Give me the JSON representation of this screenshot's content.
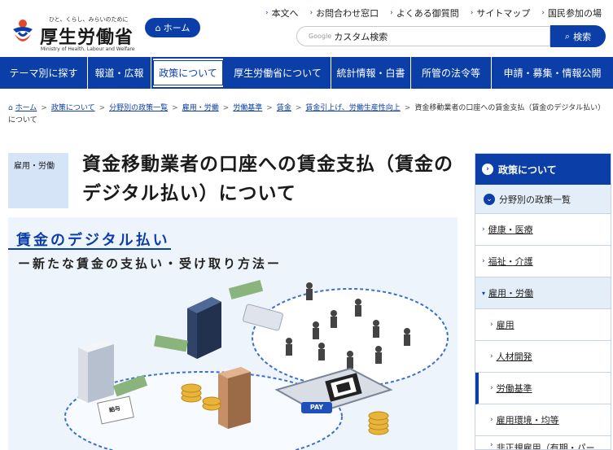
{
  "header": {
    "logo_tagline": "ひと、くらし、みらいのために",
    "logo_name": "厚生労働省",
    "logo_en": "Ministry of Health, Labour and Welfare",
    "home_button": "ホーム",
    "util_links": [
      "本文へ",
      "お問合わせ窓口",
      "よくある御質問",
      "サイトマップ",
      "国民参加の場"
    ],
    "search_brand": "Google",
    "search_placeholder": "カスタム検索",
    "search_button": "検索"
  },
  "gnav": {
    "tabs": [
      "テーマ別に探す",
      "報道・広報",
      "政策について",
      "厚生労働省について",
      "統計情報・白書",
      "所管の法令等",
      "申請・募集・情報公開"
    ],
    "active_index": 2
  },
  "breadcrumb": {
    "items": [
      "ホーム",
      "政策について",
      "分野別の政策一覧",
      "雇用・労働",
      "労働基準",
      "賃金",
      "賃金引上げ、労働生産性向上"
    ],
    "current": "資金移動業者の口座への賃金支払（賃金のデジタル払い）について"
  },
  "page": {
    "category": "雇用・労働",
    "title": "資金移動業者の口座への賃金支払（賃金のデジタル払い）について"
  },
  "hero": {
    "title": "賃金のデジタル払い",
    "subtitle": "ー新たな賃金の支払い・受け取り方法ー",
    "pay_label": "PAY",
    "payslip_label": "給与"
  },
  "sidebar": {
    "heading": "政策について",
    "subheading": "分野別の政策一覧",
    "items": [
      {
        "label": "健康・医療",
        "level": 0
      },
      {
        "label": "福祉・介護",
        "level": 0
      },
      {
        "label": "雇用・労働",
        "level": 0,
        "open": true
      },
      {
        "label": "雇用",
        "level": 1
      },
      {
        "label": "人材開発",
        "level": 1
      },
      {
        "label": "労働基準",
        "level": 1,
        "current": true
      },
      {
        "label": "雇用環境・均等",
        "level": 1
      },
      {
        "label": "非正規雇用（有期・パー",
        "level": 1
      }
    ]
  },
  "colors": {
    "brand": "#0b3fa7",
    "light": "#d5e4f7"
  }
}
